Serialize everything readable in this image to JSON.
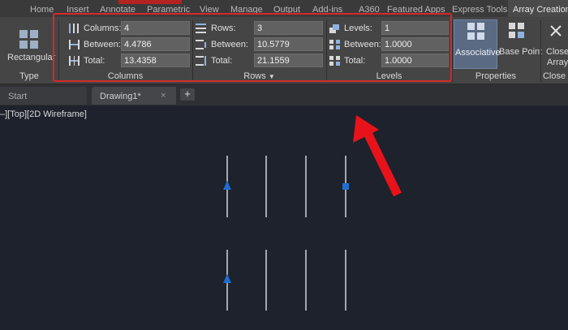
{
  "ribbon_tabs": {
    "home": "Home",
    "insert": "Insert",
    "annotate": "Annotate",
    "parametric": "Parametric",
    "view": "View",
    "manage": "Manage",
    "output": "Output",
    "addins": "Add-ins",
    "a360": "A360",
    "featured": "Featured Apps",
    "express": "Express Tools",
    "array_creation": "Array Creation"
  },
  "type_panel": {
    "button": "Rectangular",
    "title": "Type"
  },
  "columns_panel": {
    "title": "Columns",
    "columns_label": "Columns:",
    "columns_value": "4",
    "between_label": "Between:",
    "between_value": "4.4786",
    "total_label": "Total:",
    "total_value": "13.4358"
  },
  "rows_panel": {
    "title": "Rows",
    "rows_label": "Rows:",
    "rows_value": "3",
    "between_label": "Between:",
    "between_value": "10.5779",
    "total_label": "Total:",
    "total_value": "21.1559"
  },
  "levels_panel": {
    "title": "Levels",
    "levels_label": "Levels:",
    "levels_value": "1",
    "between_label": "Between:",
    "between_value": "1.0000",
    "total_label": "Total:",
    "total_value": "1.0000"
  },
  "properties_panel": {
    "associative": "Associative",
    "base_point": "Base Point",
    "title": "Properties"
  },
  "close_panel": {
    "close_line1": "Close",
    "close_line2": "Array",
    "title": "Close"
  },
  "doc_tabs": {
    "start": "Start",
    "drawing": "Drawing1*",
    "close_glyph": "×",
    "new_glyph": "+"
  },
  "viewport": {
    "label": "–][Top][2D Wireframe]"
  },
  "colors": {
    "grip_blue": "#1e6fd1",
    "highlight_red": "#d42a2a",
    "arrow_red": "#e8121a"
  }
}
